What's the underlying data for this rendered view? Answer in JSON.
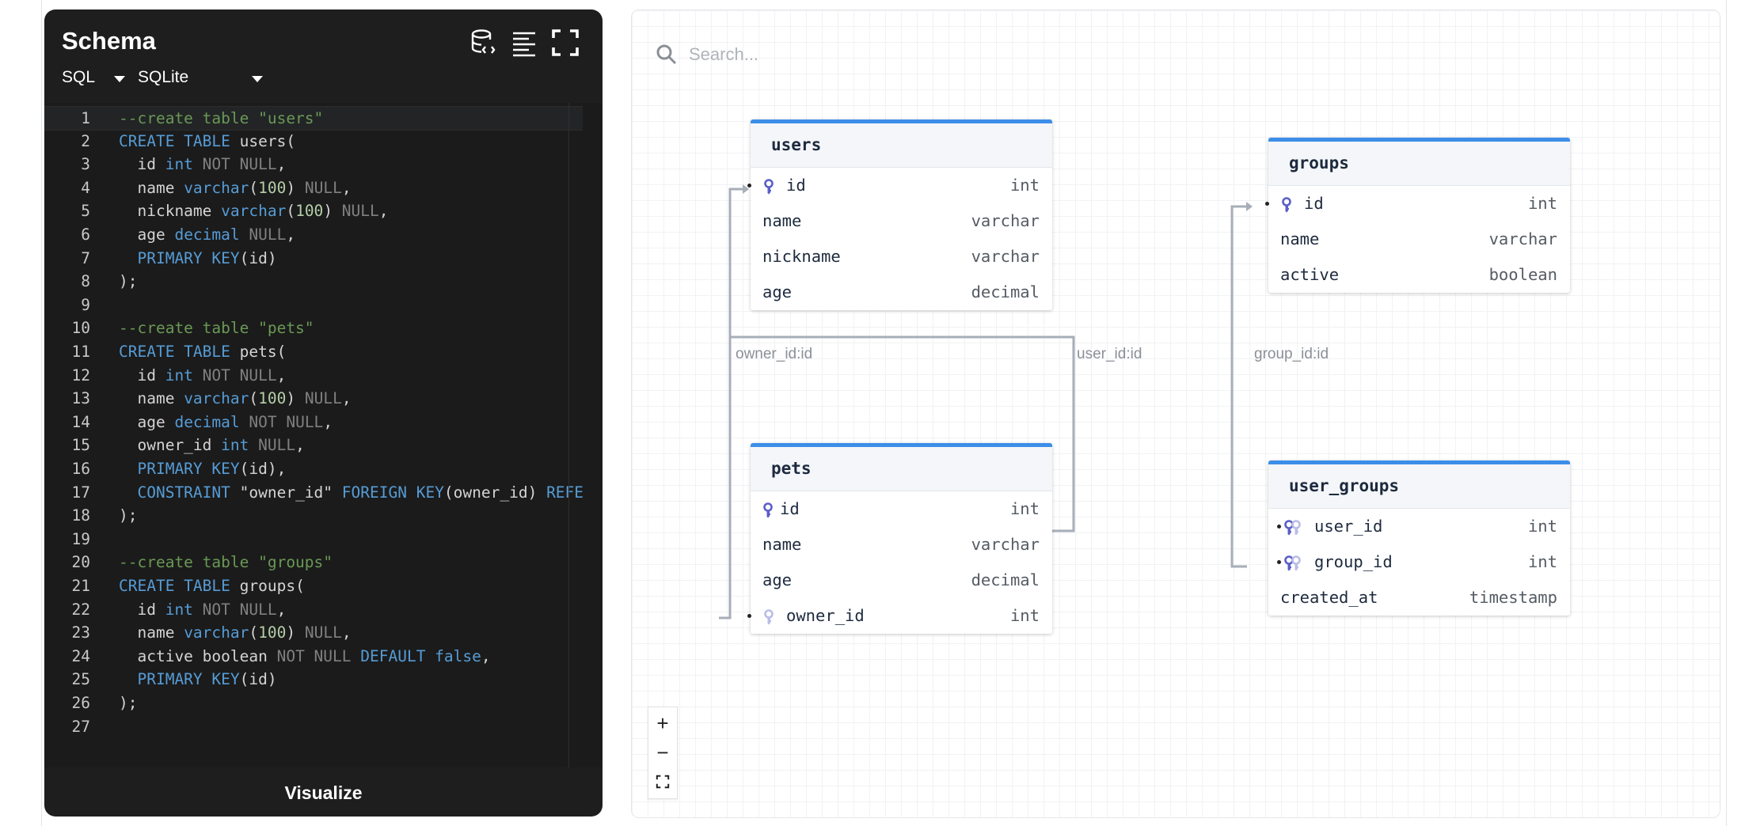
{
  "editor": {
    "title": "Schema",
    "language": "SQL",
    "dialect": "SQLite",
    "visualize_label": "Visualize",
    "icons": [
      "database-code-icon",
      "format-align-icon",
      "fullscreen-icon"
    ]
  },
  "code_lines": [
    [
      [
        "cm",
        "--create table \"users\""
      ]
    ],
    [
      [
        "kw",
        "CREATE TABLE"
      ],
      [
        "pl",
        " users("
      ]
    ],
    [
      [
        "pl",
        "  id "
      ],
      [
        "ty",
        "int"
      ],
      [
        "nu",
        " NOT NULL"
      ],
      [
        "pl",
        ","
      ]
    ],
    [
      [
        "pl",
        "  name "
      ],
      [
        "ty",
        "varchar"
      ],
      [
        "pl",
        "("
      ],
      [
        "nm",
        "100"
      ],
      [
        "pl",
        ") "
      ],
      [
        "nu",
        "NULL"
      ],
      [
        "pl",
        ","
      ]
    ],
    [
      [
        "pl",
        "  nickname "
      ],
      [
        "ty",
        "varchar"
      ],
      [
        "pl",
        "("
      ],
      [
        "nm",
        "100"
      ],
      [
        "pl",
        ") "
      ],
      [
        "nu",
        "NULL"
      ],
      [
        "pl",
        ","
      ]
    ],
    [
      [
        "pl",
        "  age "
      ],
      [
        "ty",
        "decimal"
      ],
      [
        "nu",
        " NULL"
      ],
      [
        "pl",
        ","
      ]
    ],
    [
      [
        "pl",
        "  "
      ],
      [
        "kw",
        "PRIMARY KEY"
      ],
      [
        "pl",
        "(id)"
      ]
    ],
    [
      [
        "pl",
        ");"
      ]
    ],
    [],
    [
      [
        "cm",
        "--create table \"pets\""
      ]
    ],
    [
      [
        "kw",
        "CREATE TABLE"
      ],
      [
        "pl",
        " pets("
      ]
    ],
    [
      [
        "pl",
        "  id "
      ],
      [
        "ty",
        "int"
      ],
      [
        "nu",
        " NOT NULL"
      ],
      [
        "pl",
        ","
      ]
    ],
    [
      [
        "pl",
        "  name "
      ],
      [
        "ty",
        "varchar"
      ],
      [
        "pl",
        "("
      ],
      [
        "nm",
        "100"
      ],
      [
        "pl",
        ") "
      ],
      [
        "nu",
        "NULL"
      ],
      [
        "pl",
        ","
      ]
    ],
    [
      [
        "pl",
        "  age "
      ],
      [
        "ty",
        "decimal"
      ],
      [
        "nu",
        " NOT NULL"
      ],
      [
        "pl",
        ","
      ]
    ],
    [
      [
        "pl",
        "  owner_id "
      ],
      [
        "ty",
        "int"
      ],
      [
        "nu",
        " NULL"
      ],
      [
        "pl",
        ","
      ]
    ],
    [
      [
        "pl",
        "  "
      ],
      [
        "kw",
        "PRIMARY KEY"
      ],
      [
        "pl",
        "(id),"
      ]
    ],
    [
      [
        "pl",
        "  "
      ],
      [
        "kw",
        "CONSTRAINT"
      ],
      [
        "pl",
        " \"owner_id\" "
      ],
      [
        "kw",
        "FOREIGN KEY"
      ],
      [
        "pl",
        "(owner_id) "
      ],
      [
        "kw",
        "REFE"
      ]
    ],
    [
      [
        "pl",
        ");"
      ]
    ],
    [],
    [
      [
        "cm",
        "--create table \"groups\""
      ]
    ],
    [
      [
        "kw",
        "CREATE TABLE"
      ],
      [
        "pl",
        " groups("
      ]
    ],
    [
      [
        "pl",
        "  id "
      ],
      [
        "ty",
        "int"
      ],
      [
        "nu",
        " NOT NULL"
      ],
      [
        "pl",
        ","
      ]
    ],
    [
      [
        "pl",
        "  name "
      ],
      [
        "ty",
        "varchar"
      ],
      [
        "pl",
        "("
      ],
      [
        "nm",
        "100"
      ],
      [
        "pl",
        ") "
      ],
      [
        "nu",
        "NULL"
      ],
      [
        "pl",
        ","
      ]
    ],
    [
      [
        "pl",
        "  active boolean "
      ],
      [
        "nu",
        "NOT NULL"
      ],
      [
        "kw",
        " DEFAULT false"
      ],
      [
        "pl",
        ","
      ]
    ],
    [
      [
        "pl",
        "  "
      ],
      [
        "kw",
        "PRIMARY KEY"
      ],
      [
        "pl",
        "(id)"
      ]
    ],
    [
      [
        "pl",
        ");"
      ]
    ],
    []
  ],
  "search": {
    "placeholder": "Search..."
  },
  "tables": {
    "users": {
      "name": "users",
      "columns": [
        {
          "name": "id",
          "type": "int"
        },
        {
          "name": "name",
          "type": "varchar"
        },
        {
          "name": "nickname",
          "type": "varchar"
        },
        {
          "name": "age",
          "type": "decimal"
        }
      ]
    },
    "groups": {
      "name": "groups",
      "columns": [
        {
          "name": "id",
          "type": "int"
        },
        {
          "name": "name",
          "type": "varchar"
        },
        {
          "name": "active",
          "type": "boolean"
        }
      ]
    },
    "pets": {
      "name": "pets",
      "columns": [
        {
          "name": "id",
          "type": "int"
        },
        {
          "name": "name",
          "type": "varchar"
        },
        {
          "name": "age",
          "type": "decimal"
        },
        {
          "name": "owner_id",
          "type": "int"
        }
      ]
    },
    "user_groups": {
      "name": "user_groups",
      "columns": [
        {
          "name": "user_id",
          "type": "int"
        },
        {
          "name": "group_id",
          "type": "int"
        },
        {
          "name": "created_at",
          "type": "timestamp"
        }
      ]
    }
  },
  "relations": [
    "owner_id:id",
    "user_id:id",
    "group_id:id"
  ],
  "zoom_controls": {
    "zoom_in": "+",
    "zoom_out": "−"
  },
  "colors": {
    "accent": "#3d8ee8",
    "key_icon": "#5b5fc7",
    "panel_bg": "#1e1e1e"
  }
}
